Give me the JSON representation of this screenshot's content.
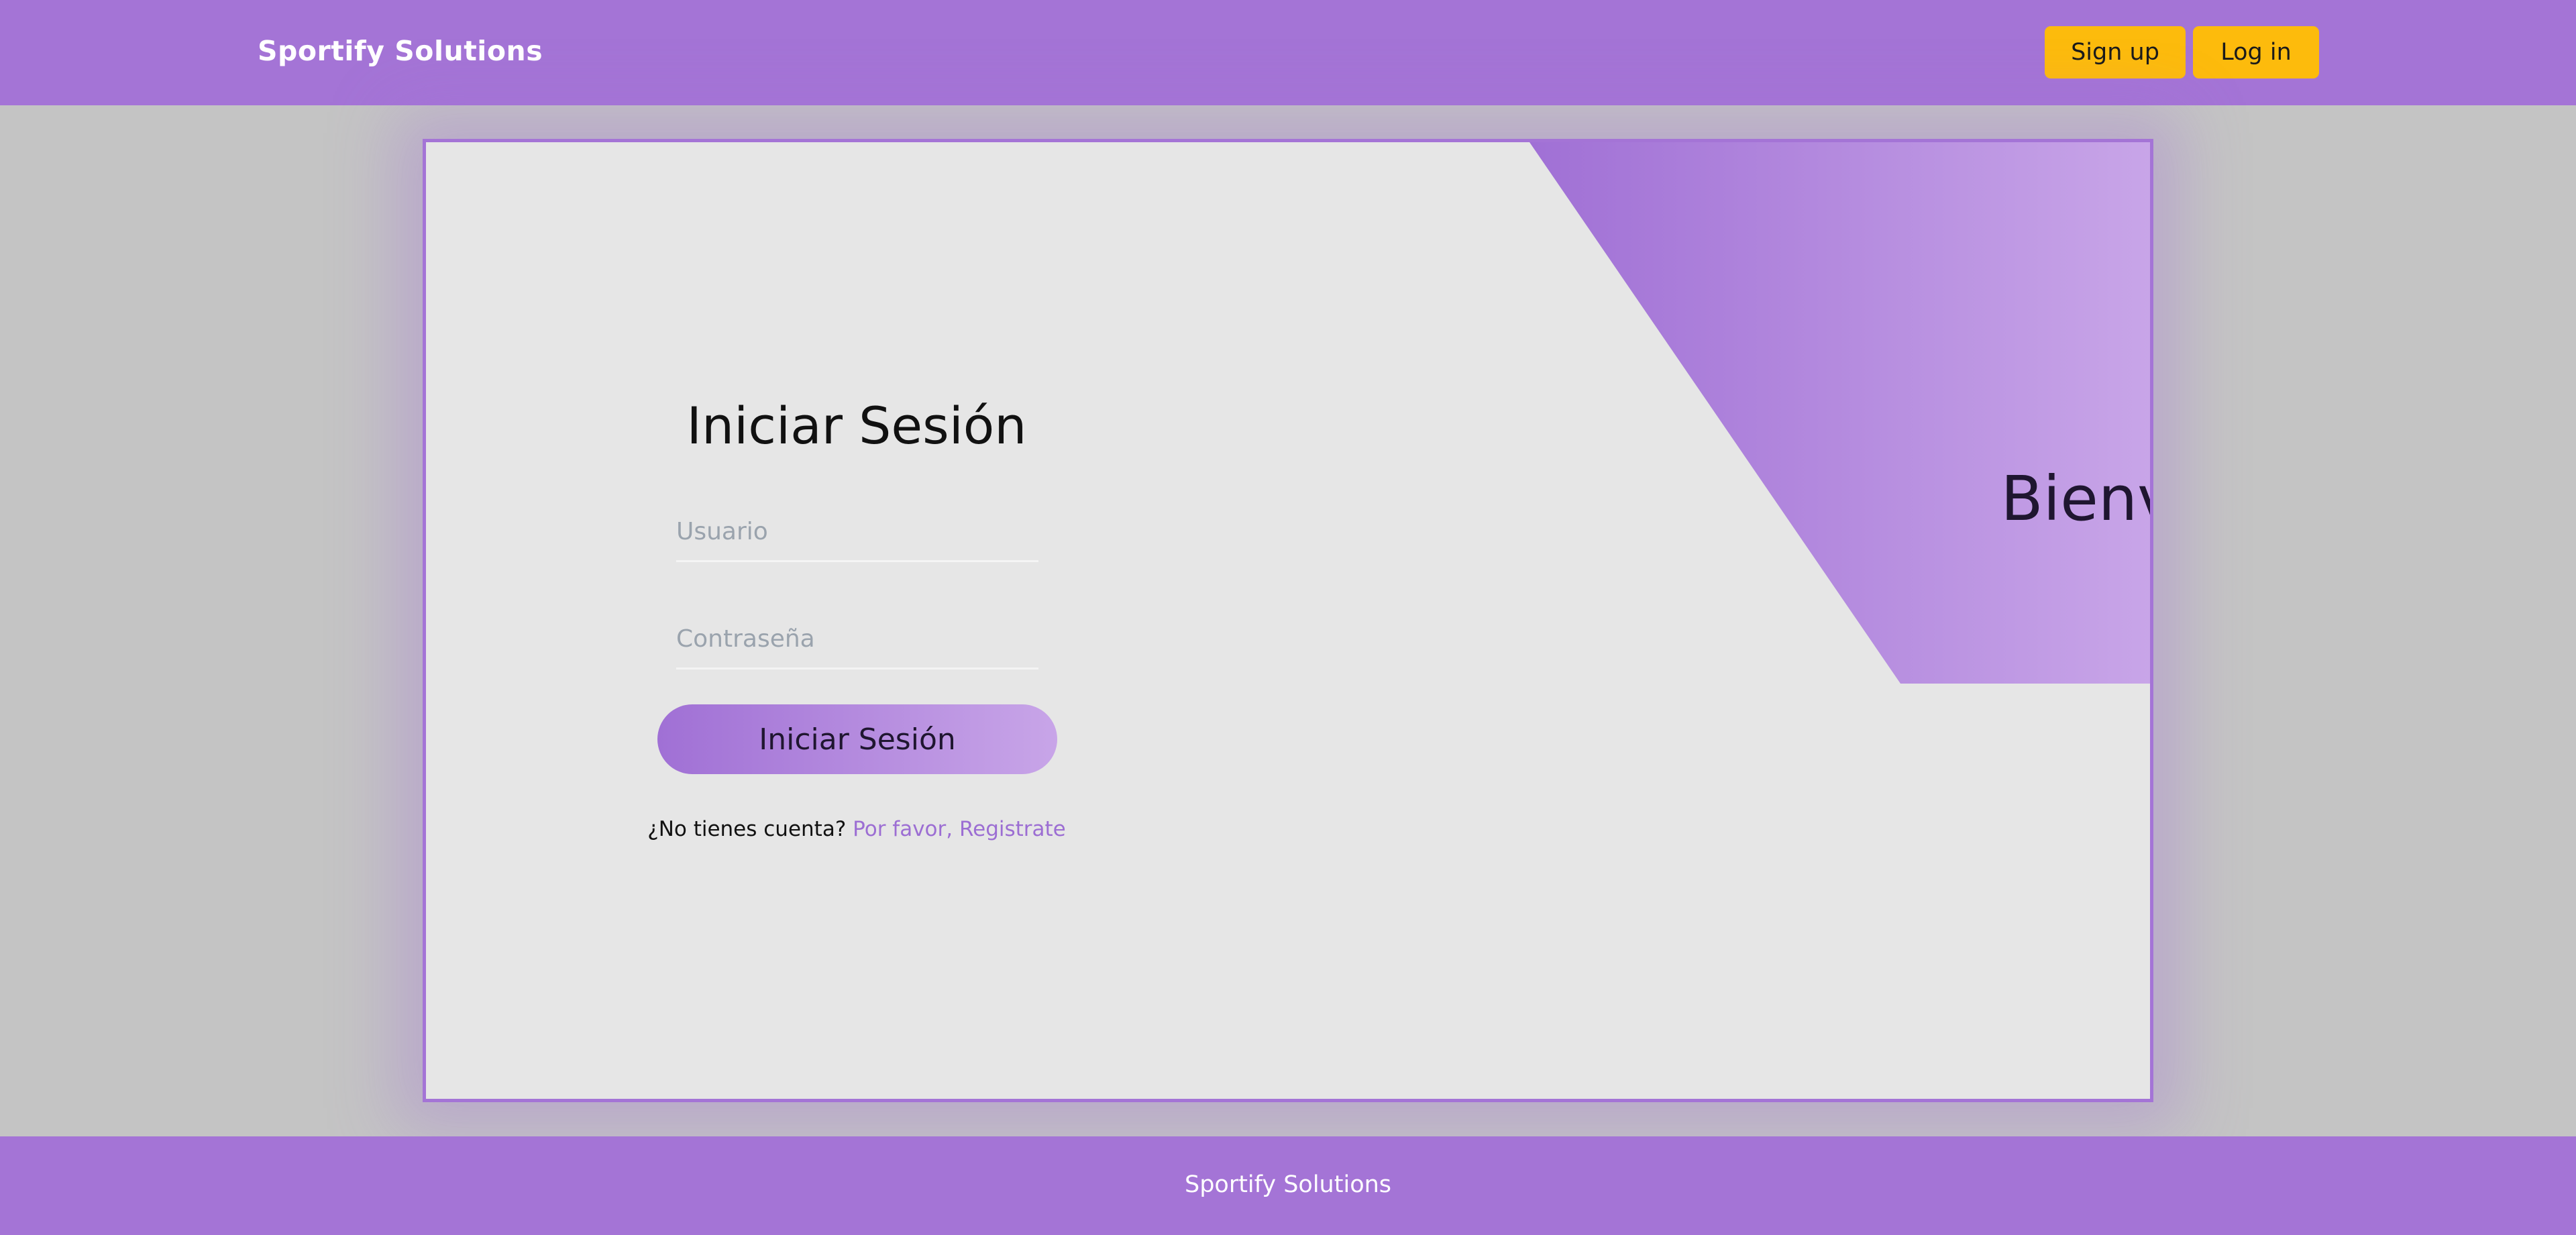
{
  "header": {
    "brand": "Sportify Solutions",
    "signup_label": "Sign up",
    "login_label": "Log in"
  },
  "colors": {
    "primary": "#a474d6",
    "accent": "#fdbb0c",
    "card_bg": "#e6e6e6",
    "page_bg": "#c4c4c4",
    "link": "#9c6ed3"
  },
  "banner": {
    "welcome": "Bienvenid@"
  },
  "login_form": {
    "title": "Iniciar Sesión",
    "username_placeholder": "Usuario",
    "password_placeholder": "Contraseña",
    "submit_label": "Iniciar Sesión",
    "no_account_text": "¿No tienes cuenta?",
    "register_link": "Por favor, Registrate"
  },
  "footer": {
    "text": "Sportify Solutions"
  }
}
